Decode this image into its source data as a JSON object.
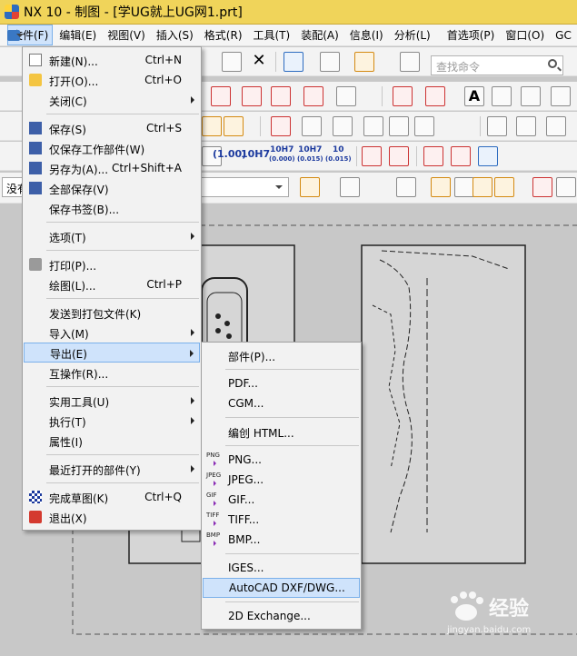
{
  "window": {
    "title": "NX 10 - 制图 - [学UG就上UG网1.prt]"
  },
  "menubar": {
    "items": [
      {
        "label": "文件(F)",
        "active": true
      },
      {
        "label": "编辑(E)"
      },
      {
        "label": "视图(V)"
      },
      {
        "label": "插入(S)"
      },
      {
        "label": "格式(R)"
      },
      {
        "label": "工具(T)"
      },
      {
        "label": "装配(A)"
      },
      {
        "label": "信息(I)"
      },
      {
        "label": "分析(L)"
      },
      {
        "label": "首选项(P)"
      },
      {
        "label": "窗口(O)"
      },
      {
        "label": "GC"
      }
    ]
  },
  "search": {
    "placeholder": "查找命令"
  },
  "filter_dropdown": {
    "value": "没有"
  },
  "toolbar_labels": {
    "precision": "(1.00)",
    "fit1": "10H7",
    "fit2_top": "10H7",
    "fit2_bottom": "(0.000)",
    "fit3_top": "10H7",
    "fit3_bottom": "(0.015)",
    "fit4_top": "10",
    "fit4_bottom": "(0.015)"
  },
  "file_menu": {
    "items": [
      {
        "label": "新建(N)...",
        "shortcut": "Ctrl+N",
        "icon": "new-file-icon"
      },
      {
        "label": "打开(O)...",
        "shortcut": "Ctrl+O",
        "icon": "open-folder-icon"
      },
      {
        "label": "关闭(C)",
        "shortcut": "",
        "submenu": true
      },
      {
        "label": "保存(S)",
        "shortcut": "Ctrl+S",
        "icon": "save-icon"
      },
      {
        "label": "仅保存工作部件(W)",
        "shortcut": "",
        "icon": "save-work-part-icon"
      },
      {
        "label": "另存为(A)...",
        "shortcut": "Ctrl+Shift+A",
        "icon": "save-as-icon"
      },
      {
        "label": "全部保存(V)",
        "shortcut": "",
        "icon": "save-all-icon"
      },
      {
        "label": "保存书签(B)...",
        "shortcut": ""
      },
      {
        "label": "选项(T)",
        "shortcut": "",
        "submenu": true
      },
      {
        "label": "打印(P)...",
        "shortcut": "",
        "icon": "print-icon"
      },
      {
        "label": "绘图(L)...",
        "shortcut": "Ctrl+P"
      },
      {
        "label": "发送到打包文件(K)",
        "shortcut": ""
      },
      {
        "label": "导入(M)",
        "shortcut": "",
        "submenu": true
      },
      {
        "label": "导出(E)",
        "shortcut": "",
        "submenu": true,
        "active": true
      },
      {
        "label": "互操作(R)...",
        "shortcut": ""
      },
      {
        "label": "实用工具(U)",
        "shortcut": "",
        "submenu": true
      },
      {
        "label": "执行(T)",
        "shortcut": "",
        "submenu": true
      },
      {
        "label": "属性(I)",
        "shortcut": ""
      },
      {
        "label": "最近打开的部件(Y)",
        "shortcut": "",
        "submenu": true
      },
      {
        "label": "完成草图(K)",
        "shortcut": "Ctrl+Q",
        "icon": "finish-sketch-icon"
      },
      {
        "label": "退出(X)",
        "shortcut": "",
        "icon": "exit-icon"
      }
    ]
  },
  "export_menu": {
    "items": [
      {
        "label": "部件(P)..."
      },
      {
        "label": "PDF..."
      },
      {
        "label": "CGM..."
      },
      {
        "label": "编创 HTML..."
      },
      {
        "label": "PNG...",
        "tag": "PNG"
      },
      {
        "label": "JPEG...",
        "tag": "JPEG"
      },
      {
        "label": "GIF...",
        "tag": "GIF"
      },
      {
        "label": "TIFF...",
        "tag": "TIFF"
      },
      {
        "label": "BMP...",
        "tag": "BMP"
      },
      {
        "label": "IGES..."
      },
      {
        "label": "AutoCAD DXF/DWG...",
        "active": true
      },
      {
        "label": "2D Exchange..."
      }
    ]
  },
  "watermark": {
    "text": "经验",
    "url": "jingyan.baidu.com"
  }
}
